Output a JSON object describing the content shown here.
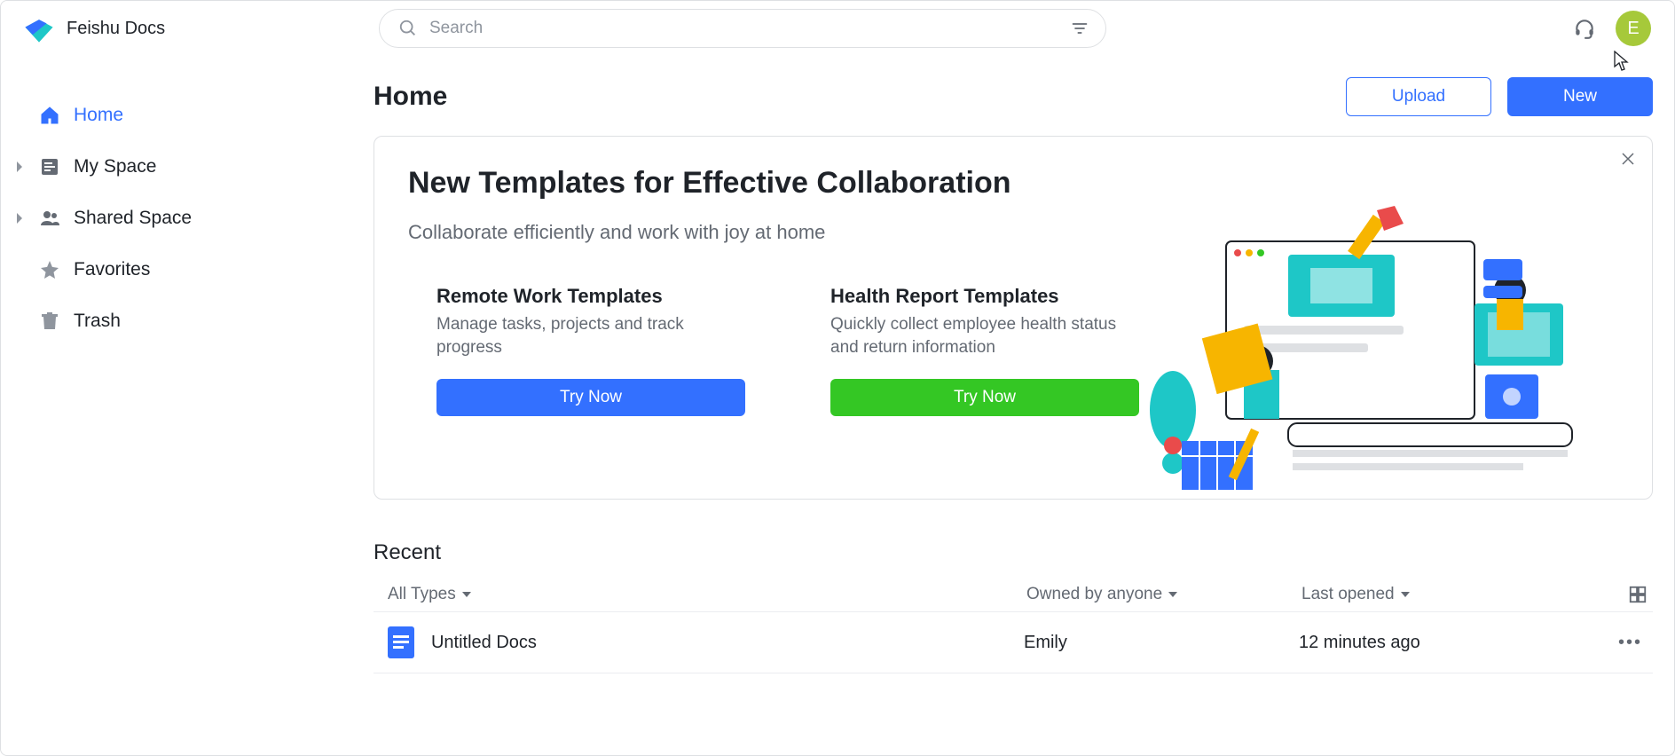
{
  "brand": {
    "name": "Feishu Docs"
  },
  "search": {
    "placeholder": "Search"
  },
  "avatar": {
    "initial": "E"
  },
  "sidebar": {
    "items": [
      {
        "label": "Home",
        "active": true,
        "expandable": false
      },
      {
        "label": "My Space",
        "active": false,
        "expandable": true
      },
      {
        "label": "Shared Space",
        "active": false,
        "expandable": true
      },
      {
        "label": "Favorites",
        "active": false,
        "expandable": false
      },
      {
        "label": "Trash",
        "active": false,
        "expandable": false
      }
    ]
  },
  "page": {
    "title": "Home"
  },
  "buttons": {
    "upload": "Upload",
    "new": "New"
  },
  "banner": {
    "title": "New Templates for Effective Collaboration",
    "subtitle": "Collaborate efficiently and work with joy at home",
    "cards": [
      {
        "title": "Remote Work Templates",
        "desc": "Manage tasks, projects and track progress",
        "cta": "Try Now",
        "color": "blue"
      },
      {
        "title": "Health Report Templates",
        "desc": "Quickly collect employee health status and return information",
        "cta": "Try Now",
        "color": "green"
      }
    ]
  },
  "recent": {
    "title": "Recent",
    "filters": {
      "types": "All Types",
      "owner": "Owned by anyone",
      "opened": "Last opened"
    },
    "rows": [
      {
        "name": "Untitled Docs",
        "owner": "Emily",
        "time": "12 minutes ago"
      }
    ]
  }
}
